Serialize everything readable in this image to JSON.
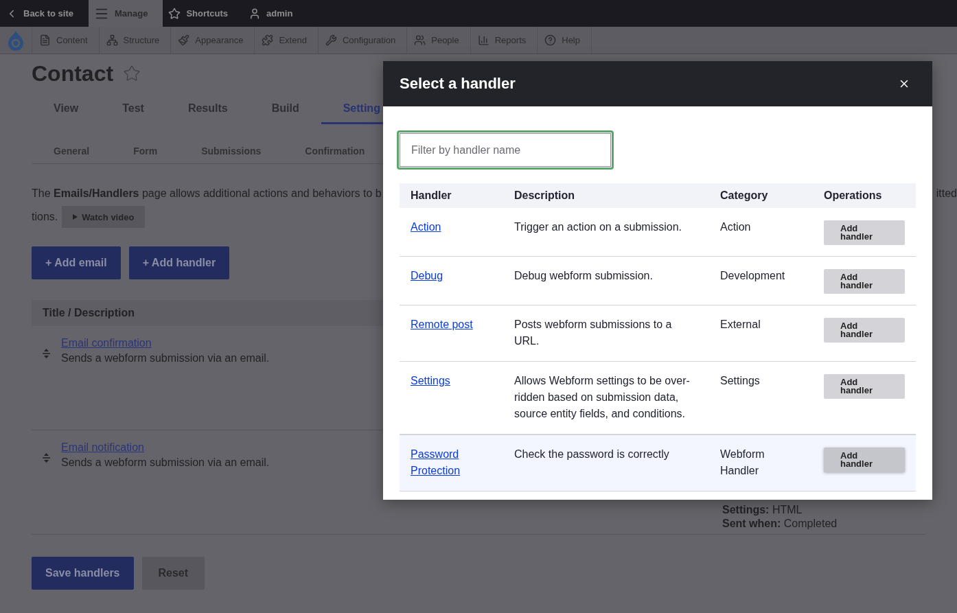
{
  "toolbar": [
    {
      "label": "Back to site",
      "selected": false
    },
    {
      "label": "Manage",
      "selected": true
    },
    {
      "label": "Shortcuts",
      "selected": false
    },
    {
      "label": "admin",
      "selected": false
    }
  ],
  "admin_menu": [
    "Content",
    "Structure",
    "Appearance",
    "Extend",
    "Configuration",
    "People",
    "Reports",
    "Help"
  ],
  "page": {
    "title": "Contact",
    "primary_tabs": [
      {
        "label": "View",
        "selected": false
      },
      {
        "label": "Test",
        "selected": false
      },
      {
        "label": "Results",
        "selected": false
      },
      {
        "label": "Build",
        "selected": false
      },
      {
        "label": "Setting",
        "selected": true
      }
    ],
    "secondary_tabs": [
      {
        "label": "General",
        "selected": false
      },
      {
        "label": "Form",
        "selected": false
      },
      {
        "label": "Submissions",
        "selected": false
      },
      {
        "label": "Confirmation",
        "selected": false
      }
    ],
    "description": "The **Emails/Handlers** page allows additional actions and behaviors to b",
    "description_tail": "itted",
    "description_line2": "tions.",
    "watch_video": "Watch video",
    "actions": [
      "+ Add email",
      "+ Add handler"
    ],
    "handlers_table": {
      "column": "Title / Description",
      "rows": [
        {
          "title": "Email confirmation",
          "description": "Sends a webform submission via an email."
        },
        {
          "title": "Email notification",
          "description": "Sends a webform submission via an email.",
          "details": [
            {
              "label": "Settings:",
              "value": "HTML"
            },
            {
              "label": "Sent when:",
              "value": "Completed"
            }
          ]
        }
      ]
    },
    "buttons": [
      {
        "label": "Save handlers",
        "kind": "primary"
      },
      {
        "label": "Reset",
        "kind": "secondary"
      }
    ]
  },
  "dialog": {
    "title": "Select a handler",
    "filter": {
      "placeholder": "Filter by handler name"
    },
    "columns": [
      "Handler",
      "Description",
      "Category",
      "Operations"
    ],
    "rows": [
      {
        "name": "Action",
        "description": "Trigger an action on a submission.",
        "category": "Action",
        "operation": "Add handler",
        "highlighted": false
      },
      {
        "name": "Debug",
        "description": "Debug webform submission.",
        "category": "Development",
        "operation": "Add handler",
        "highlighted": false
      },
      {
        "name": "Remote post",
        "description": "Posts webform submissions to a URL.",
        "category": "External",
        "operation": "Add handler",
        "highlighted": false
      },
      {
        "name": "Settings",
        "description": "Allows Webform settings to be over-ridden based on submission data, source entity fields, and conditions.",
        "category": "Settings",
        "operation": "Add handler",
        "highlighted": false
      },
      {
        "name": "Password Protection",
        "description": "Check the password is correctly",
        "category": "Webform Handler",
        "operation": "Add handler",
        "highlighted": true
      }
    ]
  }
}
